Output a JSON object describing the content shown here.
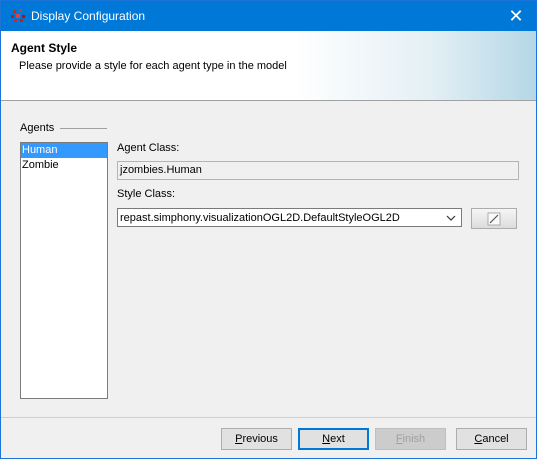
{
  "window": {
    "title": "Display Configuration",
    "close_glyph": "✕"
  },
  "header": {
    "title": "Agent Style",
    "subtitle": "Please provide a style for each agent type in the model"
  },
  "agents": {
    "label": "Agents",
    "items": [
      {
        "label": "Human",
        "selected": true
      },
      {
        "label": "Zombie",
        "selected": false
      }
    ]
  },
  "agent_class": {
    "label": "Agent Class:",
    "value": "jzombies.Human"
  },
  "style_class": {
    "label": "Style Class:",
    "value": "repast.simphony.visualizationOGL2D.DefaultStyleOGL2D",
    "edit_icon": "pencil-edit-icon"
  },
  "buttons": {
    "previous": {
      "mnemonic": "P",
      "rest": "revious"
    },
    "next": {
      "mnemonic": "N",
      "rest": "ext"
    },
    "finish": {
      "mnemonic": "F",
      "rest": "inish"
    },
    "cancel": {
      "mnemonic": "C",
      "rest": "ancel"
    }
  },
  "colors": {
    "titlebar": "#0078d7",
    "selection": "#3399ff",
    "header_gradient_end": "#b4d7e6"
  }
}
